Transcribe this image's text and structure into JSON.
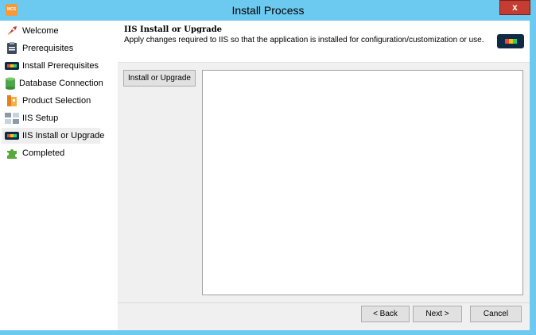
{
  "window": {
    "title": "Install Process",
    "app_icon_text": "MCS",
    "close_label": "x"
  },
  "sidebar": {
    "items": [
      {
        "label": "Welcome",
        "icon": "rocket-icon"
      },
      {
        "label": "Prerequisites",
        "icon": "clipboard-icon"
      },
      {
        "label": "Install Prerequisites",
        "icon": "colored-dots-icon"
      },
      {
        "label": "Database Connection",
        "icon": "database-icon"
      },
      {
        "label": "Product Selection",
        "icon": "product-box-icon"
      },
      {
        "label": "IIS Setup",
        "icon": "windows-grid-icon"
      },
      {
        "label": "IIS Install or Upgrade",
        "icon": "colored-dots-icon",
        "active": true
      },
      {
        "label": "Completed",
        "icon": "puzzle-icon"
      }
    ]
  },
  "header": {
    "title": "IIS Install or Upgrade",
    "subtitle": "Apply changes required to IIS so that the application is installed for configuration/customization or use.",
    "badge_icon": "colored-dots-icon"
  },
  "main": {
    "step_button": "Install or Upgrade",
    "log_text": ""
  },
  "footer": {
    "back_label": "< Back",
    "next_label": "Next >",
    "cancel_label": "Cancel"
  },
  "colors": {
    "titlebar": "#6cc9ef",
    "close": "#c43c32",
    "panel": "#f0f0f0"
  }
}
